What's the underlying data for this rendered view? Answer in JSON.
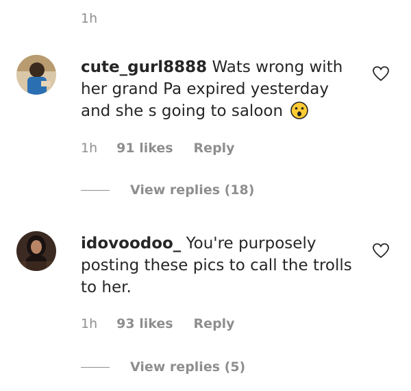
{
  "top_time": "1h",
  "comments": [
    {
      "username": "cute_gurl8888",
      "text": "Wats wrong with her grand Pa expired yesterday and she s going to saloon",
      "emoji": "astonished-face-emoji",
      "time": "1h",
      "likes": "91 likes",
      "reply": "Reply",
      "view_replies": "View replies (18)"
    },
    {
      "username": "idovoodoo_",
      "text": "You're purposely posting these pics to call the trolls to her.",
      "time": "1h",
      "likes": "93 likes",
      "reply": "Reply",
      "view_replies": "View replies (5)"
    }
  ]
}
